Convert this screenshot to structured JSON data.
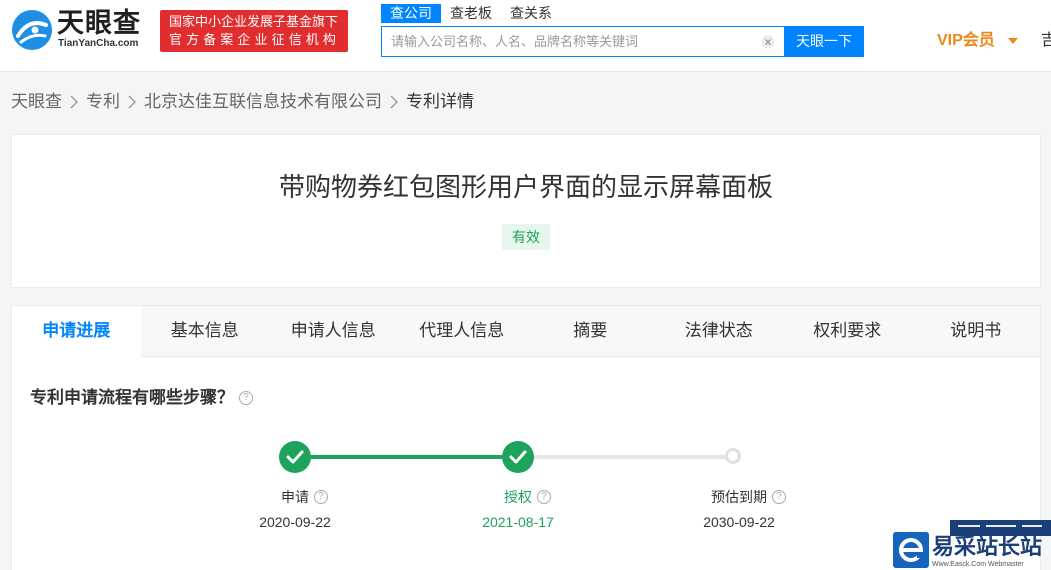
{
  "header": {
    "logo": {
      "name": "天眼查",
      "domain": "TianYanCha.com"
    },
    "gov_badge": {
      "line1": "国家中小企业发展子基金旗下",
      "line2": "官方备案企业征信机构"
    },
    "search": {
      "tabs": [
        {
          "label": "查公司",
          "active": true
        },
        {
          "label": "查老板",
          "active": false
        },
        {
          "label": "查关系",
          "active": false
        }
      ],
      "placeholder": "请输入公司名称、人名、品牌名称等关键词",
      "button_label": "天眼一下"
    },
    "vip_label": "VIP会员",
    "user_label": "吉"
  },
  "breadcrumb": [
    {
      "label": "天眼查"
    },
    {
      "label": "专利"
    },
    {
      "label": "北京达佳互联信息技术有限公司"
    },
    {
      "label": "专利详情"
    }
  ],
  "patent": {
    "title": "带购物券红包图形用户界面的显示屏幕面板",
    "status": "有效"
  },
  "tabs": [
    {
      "label": "申请进展"
    },
    {
      "label": "基本信息"
    },
    {
      "label": "申请人信息"
    },
    {
      "label": "代理人信息"
    },
    {
      "label": "摘要"
    },
    {
      "label": "法律状态"
    },
    {
      "label": "权利要求"
    },
    {
      "label": "说明书"
    }
  ],
  "active_tab": 0,
  "progress": {
    "heading": "专利申请流程有哪些步骤？",
    "steps": [
      {
        "label": "申请",
        "date": "2020-09-22",
        "done": true,
        "current": false
      },
      {
        "label": "授权",
        "date": "2021-08-17",
        "done": true,
        "current": true
      },
      {
        "label": "预估到期",
        "date": "2030-09-22",
        "done": false,
        "current": false
      }
    ]
  },
  "watermark": {
    "name": "易采站长站",
    "subtitle": "Www.Easck.Com Webmaster"
  },
  "colors": {
    "primary": "#0084ff",
    "red": "#e12d2d",
    "vip": "#f0861a",
    "success": "#1ea35d",
    "success_bg": "#e6f6ed",
    "line": "#e5e5e5"
  }
}
